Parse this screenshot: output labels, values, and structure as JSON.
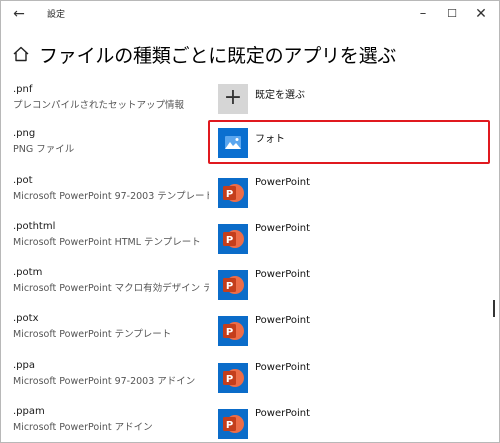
{
  "window": {
    "title": "設定",
    "back_icon": "arrow-left-icon",
    "minimize_icon": "minimize-icon",
    "maximize_icon": "maximize-icon",
    "close_icon": "close-icon"
  },
  "page": {
    "home_icon": "home-icon",
    "title": "ファイルの種類ごとに既定のアプリを選ぶ"
  },
  "colors": {
    "highlight": "#e0191f",
    "ppt_tile": "#0b6cc9",
    "ppt_logo": "#d24726",
    "photo_tile": "#0a6fd0",
    "plus_tile": "#d6d6d6"
  },
  "rows": [
    {
      "ext": ".pnf",
      "desc": "プレコンパイルされたセットアップ情報",
      "app": "既定を選ぶ",
      "icon": "plus-icon"
    },
    {
      "ext": ".png",
      "desc": "PNG ファイル",
      "app": "フォト",
      "icon": "photos-icon"
    },
    {
      "ext": ".pot",
      "desc": "Microsoft PowerPoint 97-2003 テンプレート",
      "app": "PowerPoint",
      "icon": "powerpoint-icon"
    },
    {
      "ext": ".pothtml",
      "desc": "Microsoft PowerPoint HTML テンプレート",
      "app": "PowerPoint",
      "icon": "powerpoint-icon"
    },
    {
      "ext": ".potm",
      "desc": "Microsoft PowerPoint マクロ有効デザイン テ...",
      "app": "PowerPoint",
      "icon": "powerpoint-icon"
    },
    {
      "ext": ".potx",
      "desc": "Microsoft PowerPoint テンプレート",
      "app": "PowerPoint",
      "icon": "powerpoint-icon"
    },
    {
      "ext": ".ppa",
      "desc": "Microsoft PowerPoint 97-2003 アドイン",
      "app": "PowerPoint",
      "icon": "powerpoint-icon"
    },
    {
      "ext": ".ppam",
      "desc": "Microsoft PowerPoint アドイン",
      "app": "PowerPoint",
      "icon": "powerpoint-icon"
    }
  ]
}
